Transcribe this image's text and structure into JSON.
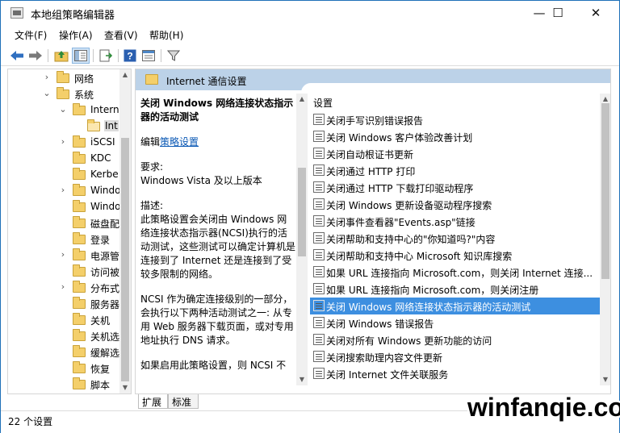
{
  "window": {
    "title": "本地组策略编辑器",
    "minimize": "—",
    "maximize": "☐",
    "close": "✕"
  },
  "menu": [
    "文件(F)",
    "操作(A)",
    "查看(V)",
    "帮助(H)"
  ],
  "toolbar_icons": [
    "back-arrow-icon",
    "forward-arrow-icon",
    "up-folder-icon",
    "show-hide-tree-icon",
    "export-list-icon",
    "help-icon",
    "properties-icon",
    "filter-icon"
  ],
  "tree": {
    "items": [
      {
        "label": "网络",
        "expander": "›"
      },
      {
        "label": "系统",
        "expander": "⌄"
      },
      {
        "label": "Interne",
        "expander": "⌄"
      },
      {
        "label": "Int",
        "expander": ""
      },
      {
        "label": "iSCSI",
        "expander": "›"
      },
      {
        "label": "KDC",
        "expander": ""
      },
      {
        "label": "Kerbe",
        "expander": ""
      },
      {
        "label": "Windo",
        "expander": "›"
      },
      {
        "label": "Windo",
        "expander": ""
      },
      {
        "label": "磁盘配",
        "expander": ""
      },
      {
        "label": "登录",
        "expander": ""
      },
      {
        "label": "电源管",
        "expander": "›"
      },
      {
        "label": "访问被",
        "expander": ""
      },
      {
        "label": "分布式",
        "expander": "›"
      },
      {
        "label": "服务器",
        "expander": ""
      },
      {
        "label": "关机",
        "expander": ""
      },
      {
        "label": "关机选",
        "expander": ""
      },
      {
        "label": "缓解选",
        "expander": ""
      },
      {
        "label": "恢复",
        "expander": ""
      },
      {
        "label": "脚本",
        "expander": ""
      }
    ]
  },
  "right_pane": {
    "header_title": "Internet 通信设置",
    "description": {
      "title": "关闭 Windows 网络连接状态指示器的活动测试",
      "edit_prefix": "编辑",
      "edit_link": "策略设置",
      "req_label": "要求:",
      "req_value": "Windows Vista 及以上版本",
      "desc_label": "描述:",
      "desc_p1": "此策略设置会关闭由 Windows 网络连接状态指示器(NCSI)执行的活动测试，这些测试可以确定计算机是连接到了 Internet 还是连接到了受较多限制的网络。",
      "desc_p2": "NCSI 作为确定连接级别的一部分，会执行以下两种活动测试之一: 从专用 Web 服务器下载页面，或对专用地址执行 DNS 请求。",
      "desc_p3": "如果启用此策略设置，则 NCSI 不"
    },
    "list_header": "设置",
    "settings": [
      "关闭手写识别错误报告",
      "关闭 Windows 客户体验改善计划",
      "关闭自动根证书更新",
      "关闭通过 HTTP 打印",
      "关闭通过 HTTP 下载打印驱动程序",
      "关闭 Windows 更新设备驱动程序搜索",
      "关闭事件查看器\"Events.asp\"链接",
      "关闭帮助和支持中心的\"你知道吗?\"内容",
      "关闭帮助和支持中心 Microsoft 知识库搜索",
      "如果 URL 连接指向 Microsoft.com，则关闭 Internet 连接...",
      "如果 URL 连接指向 Microsoft.com，则关闭注册",
      "关闭 Windows 网络连接状态指示器的活动测试",
      "关闭 Windows 错误报告",
      "关闭对所有 Windows 更新功能的访问",
      "关闭搜索助理内容文件更新",
      "关闭 Internet 文件关联服务"
    ],
    "selected_index": 11,
    "tabs": [
      "扩展",
      "标准"
    ]
  },
  "status": {
    "text": "22 个设置"
  },
  "watermark": "winfanqie.com"
}
